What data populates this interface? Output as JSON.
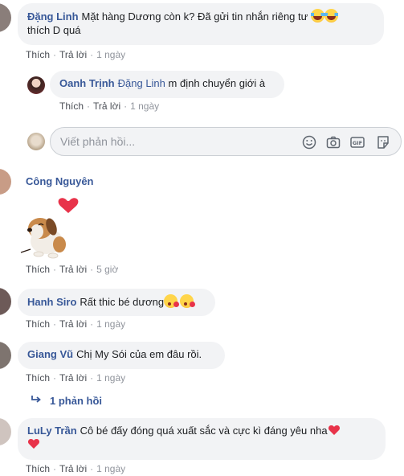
{
  "comments": [
    {
      "author": "Đặng Linh",
      "text_line1": "Mặt hàng Dương còn k? Đã gửi tin nhắn riêng tư",
      "text_line2": "thích D quá",
      "like": "Thích",
      "reply": "Trả lời",
      "time": "1 ngày"
    },
    {
      "author": "Oanh Trịnh",
      "mention": "Đặng Linh",
      "text": "m định chuyển giới à",
      "like": "Thích",
      "reply": "Trả lời",
      "time": "1 ngày"
    },
    {
      "author": "Công Nguyên",
      "like": "Thích",
      "reply": "Trả lời",
      "time": "5 giờ"
    },
    {
      "author": "Hanh Siro",
      "text": "Rất thic bé dương",
      "like": "Thích",
      "reply": "Trả lời",
      "time": "1 ngày"
    },
    {
      "author": "Giang Vũ",
      "text": "Chị My Sói của em đâu rồi.",
      "like": "Thích",
      "reply": "Trả lời",
      "time": "1 ngày"
    },
    {
      "author": "LuLy Trần",
      "text": "Cô bé đấy đóng quá xuất sắc và cực kì đáng yêu nha",
      "like": "Thích",
      "reply": "Trả lời",
      "time": "1 ngày"
    }
  ],
  "reply_input": {
    "placeholder": "Viết phản hồi..."
  },
  "view_replies": "1 phản hồi",
  "icons": {
    "emoji": "smiley-icon",
    "camera": "camera-icon",
    "gif": "gif-icon",
    "sticker": "sticker-icon",
    "reply_arrow": "reply-arrow-icon"
  },
  "colors": {
    "link": "#385898",
    "bubble": "#f2f3f5",
    "meta": "#90949c",
    "heart": "#e8334a"
  }
}
